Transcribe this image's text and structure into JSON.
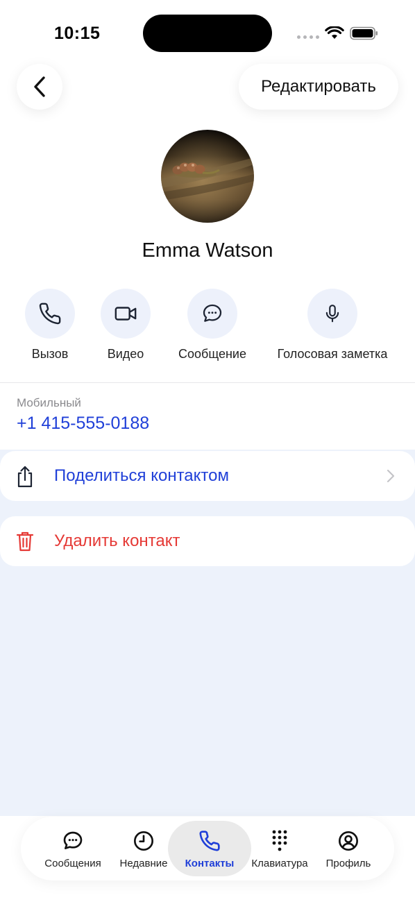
{
  "status_bar": {
    "time": "10:15"
  },
  "header": {
    "back_icon": "chevron-left-icon",
    "edit_label": "Редактировать"
  },
  "contact": {
    "name": "Emma Watson",
    "avatar": "photo"
  },
  "actions": [
    {
      "label": "Вызов",
      "icon": "phone-icon"
    },
    {
      "label": "Видео",
      "icon": "video-icon"
    },
    {
      "label": "Сообщение",
      "icon": "message-icon"
    },
    {
      "label": "Голосовая заметка",
      "icon": "microphone-icon"
    }
  ],
  "phone": {
    "caption": "Мобильный",
    "value": "+1 415-555-0188"
  },
  "share": {
    "label": "Поделиться контактом",
    "icon": "share-icon"
  },
  "delete": {
    "label": "Удалить контакт",
    "icon": "trash-icon"
  },
  "tabs": [
    {
      "label": "Сообщения",
      "icon": "message-icon",
      "active": false
    },
    {
      "label": "Недавние",
      "icon": "clock-icon",
      "active": false
    },
    {
      "label": "Контакты",
      "icon": "phone-icon",
      "active": true
    },
    {
      "label": "Клавиатура",
      "icon": "keypad-icon",
      "active": false
    },
    {
      "label": "Профиль",
      "icon": "profile-icon",
      "active": false
    }
  ],
  "colors": {
    "accent": "#1f3fd8",
    "danger": "#e53935",
    "background": "#edf2fb",
    "action_circle": "#edf1fb"
  }
}
